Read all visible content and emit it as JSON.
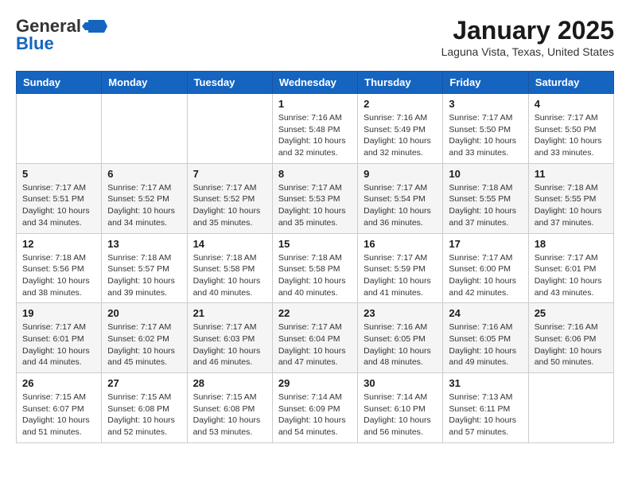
{
  "header": {
    "logo_general": "General",
    "logo_blue": "Blue",
    "month_title": "January 2025",
    "location": "Laguna Vista, Texas, United States"
  },
  "weekdays": [
    "Sunday",
    "Monday",
    "Tuesday",
    "Wednesday",
    "Thursday",
    "Friday",
    "Saturday"
  ],
  "weeks": [
    [
      {
        "day": "",
        "info": ""
      },
      {
        "day": "",
        "info": ""
      },
      {
        "day": "",
        "info": ""
      },
      {
        "day": "1",
        "info": "Sunrise: 7:16 AM\nSunset: 5:48 PM\nDaylight: 10 hours\nand 32 minutes."
      },
      {
        "day": "2",
        "info": "Sunrise: 7:16 AM\nSunset: 5:49 PM\nDaylight: 10 hours\nand 32 minutes."
      },
      {
        "day": "3",
        "info": "Sunrise: 7:17 AM\nSunset: 5:50 PM\nDaylight: 10 hours\nand 33 minutes."
      },
      {
        "day": "4",
        "info": "Sunrise: 7:17 AM\nSunset: 5:50 PM\nDaylight: 10 hours\nand 33 minutes."
      }
    ],
    [
      {
        "day": "5",
        "info": "Sunrise: 7:17 AM\nSunset: 5:51 PM\nDaylight: 10 hours\nand 34 minutes."
      },
      {
        "day": "6",
        "info": "Sunrise: 7:17 AM\nSunset: 5:52 PM\nDaylight: 10 hours\nand 34 minutes."
      },
      {
        "day": "7",
        "info": "Sunrise: 7:17 AM\nSunset: 5:52 PM\nDaylight: 10 hours\nand 35 minutes."
      },
      {
        "day": "8",
        "info": "Sunrise: 7:17 AM\nSunset: 5:53 PM\nDaylight: 10 hours\nand 35 minutes."
      },
      {
        "day": "9",
        "info": "Sunrise: 7:17 AM\nSunset: 5:54 PM\nDaylight: 10 hours\nand 36 minutes."
      },
      {
        "day": "10",
        "info": "Sunrise: 7:18 AM\nSunset: 5:55 PM\nDaylight: 10 hours\nand 37 minutes."
      },
      {
        "day": "11",
        "info": "Sunrise: 7:18 AM\nSunset: 5:55 PM\nDaylight: 10 hours\nand 37 minutes."
      }
    ],
    [
      {
        "day": "12",
        "info": "Sunrise: 7:18 AM\nSunset: 5:56 PM\nDaylight: 10 hours\nand 38 minutes."
      },
      {
        "day": "13",
        "info": "Sunrise: 7:18 AM\nSunset: 5:57 PM\nDaylight: 10 hours\nand 39 minutes."
      },
      {
        "day": "14",
        "info": "Sunrise: 7:18 AM\nSunset: 5:58 PM\nDaylight: 10 hours\nand 40 minutes."
      },
      {
        "day": "15",
        "info": "Sunrise: 7:18 AM\nSunset: 5:58 PM\nDaylight: 10 hours\nand 40 minutes."
      },
      {
        "day": "16",
        "info": "Sunrise: 7:17 AM\nSunset: 5:59 PM\nDaylight: 10 hours\nand 41 minutes."
      },
      {
        "day": "17",
        "info": "Sunrise: 7:17 AM\nSunset: 6:00 PM\nDaylight: 10 hours\nand 42 minutes."
      },
      {
        "day": "18",
        "info": "Sunrise: 7:17 AM\nSunset: 6:01 PM\nDaylight: 10 hours\nand 43 minutes."
      }
    ],
    [
      {
        "day": "19",
        "info": "Sunrise: 7:17 AM\nSunset: 6:01 PM\nDaylight: 10 hours\nand 44 minutes."
      },
      {
        "day": "20",
        "info": "Sunrise: 7:17 AM\nSunset: 6:02 PM\nDaylight: 10 hours\nand 45 minutes."
      },
      {
        "day": "21",
        "info": "Sunrise: 7:17 AM\nSunset: 6:03 PM\nDaylight: 10 hours\nand 46 minutes."
      },
      {
        "day": "22",
        "info": "Sunrise: 7:17 AM\nSunset: 6:04 PM\nDaylight: 10 hours\nand 47 minutes."
      },
      {
        "day": "23",
        "info": "Sunrise: 7:16 AM\nSunset: 6:05 PM\nDaylight: 10 hours\nand 48 minutes."
      },
      {
        "day": "24",
        "info": "Sunrise: 7:16 AM\nSunset: 6:05 PM\nDaylight: 10 hours\nand 49 minutes."
      },
      {
        "day": "25",
        "info": "Sunrise: 7:16 AM\nSunset: 6:06 PM\nDaylight: 10 hours\nand 50 minutes."
      }
    ],
    [
      {
        "day": "26",
        "info": "Sunrise: 7:15 AM\nSunset: 6:07 PM\nDaylight: 10 hours\nand 51 minutes."
      },
      {
        "day": "27",
        "info": "Sunrise: 7:15 AM\nSunset: 6:08 PM\nDaylight: 10 hours\nand 52 minutes."
      },
      {
        "day": "28",
        "info": "Sunrise: 7:15 AM\nSunset: 6:08 PM\nDaylight: 10 hours\nand 53 minutes."
      },
      {
        "day": "29",
        "info": "Sunrise: 7:14 AM\nSunset: 6:09 PM\nDaylight: 10 hours\nand 54 minutes."
      },
      {
        "day": "30",
        "info": "Sunrise: 7:14 AM\nSunset: 6:10 PM\nDaylight: 10 hours\nand 56 minutes."
      },
      {
        "day": "31",
        "info": "Sunrise: 7:13 AM\nSunset: 6:11 PM\nDaylight: 10 hours\nand 57 minutes."
      },
      {
        "day": "",
        "info": ""
      }
    ]
  ]
}
